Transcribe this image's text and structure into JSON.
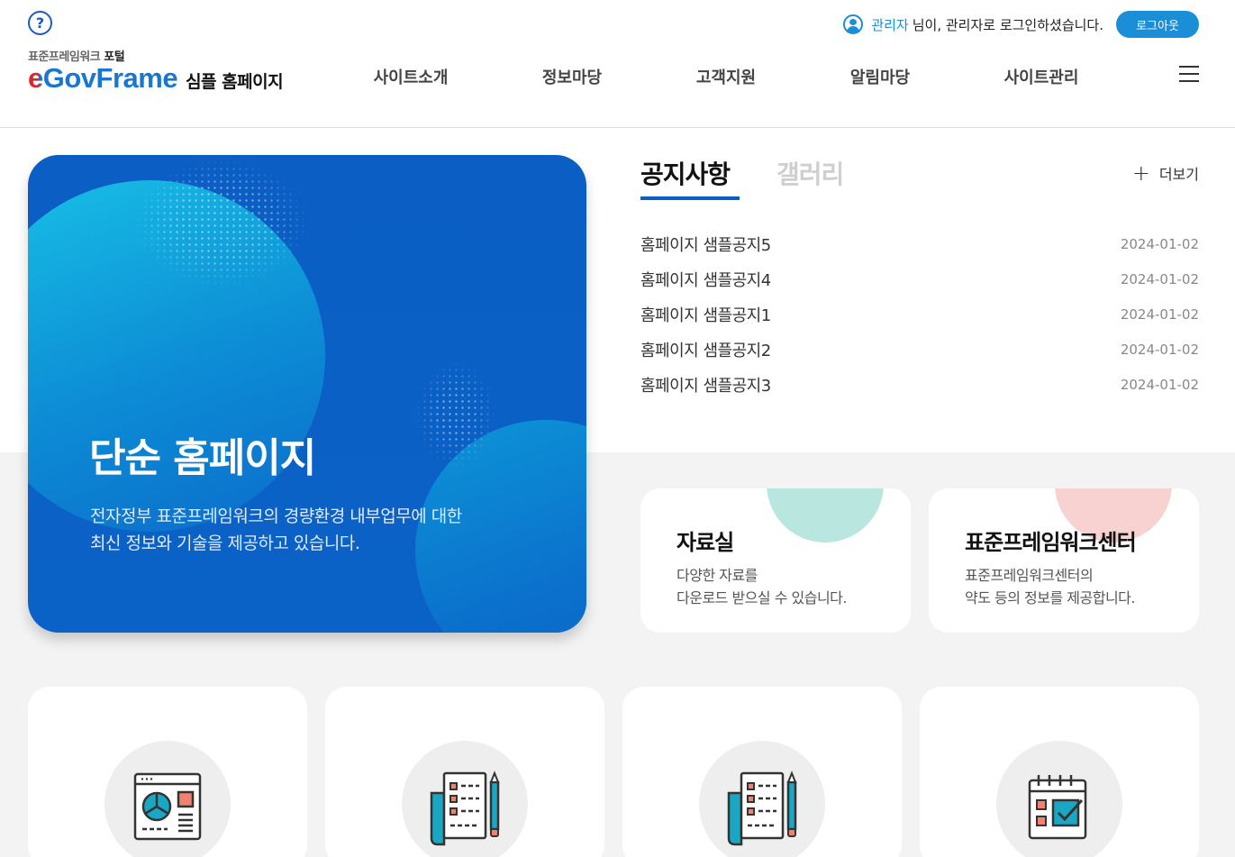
{
  "header": {
    "help_symbol": "?",
    "logo_top_prefix": "표준프레임워크 ",
    "logo_top_bold": "포털",
    "logo_main": "eGovFrame",
    "logo_sub": "심플 홈페이지",
    "user_name": "관리자",
    "user_message": "님이, 관리자로 로그인하셨습니다.",
    "logout_label": "로그아웃",
    "nav": [
      {
        "label": "사이트소개"
      },
      {
        "label": "정보마당"
      },
      {
        "label": "고객지원"
      },
      {
        "label": "알림마당"
      },
      {
        "label": "사이트관리"
      }
    ]
  },
  "hero": {
    "title": "단순 홈페이지",
    "desc_line1": "전자정부 표준프레임워크의 경량환경 내부업무에 대한",
    "desc_line2": "최신 정보와 기술을 제공하고 있습니다."
  },
  "board": {
    "tab_active": "공지사항",
    "tab_inactive": "갤러리",
    "more_label": "더보기",
    "items": [
      {
        "title": "홈페이지 샘플공지5",
        "date": "2024-01-02"
      },
      {
        "title": "홈페이지 샘플공지4",
        "date": "2024-01-02"
      },
      {
        "title": "홈페이지 샘플공지1",
        "date": "2024-01-02"
      },
      {
        "title": "홈페이지 샘플공지2",
        "date": "2024-01-02"
      },
      {
        "title": "홈페이지 샘플공지3",
        "date": "2024-01-02"
      }
    ]
  },
  "quick_cards": [
    {
      "title": "자료실",
      "desc_line1": "다양한 자료를",
      "desc_line2": "다운로드 받으실 수 있습니다.",
      "accent": "#b9e6de"
    },
    {
      "title": "표준프레임워크센터",
      "desc_line1": "표준프레임워크센터의",
      "desc_line2": "약도 등의 정보를 제공합니다.",
      "accent": "#f8d1d1"
    }
  ],
  "service_cards": [
    {
      "icon": "dashboard-chart-icon"
    },
    {
      "icon": "checklist-pencil-icon"
    },
    {
      "icon": "checklist-pencil-icon"
    },
    {
      "icon": "calendar-check-icon"
    }
  ],
  "colors": {
    "primary": "#0b5ec2",
    "accent_blue": "#1a8fd8",
    "logo_red": "#d7272f"
  }
}
